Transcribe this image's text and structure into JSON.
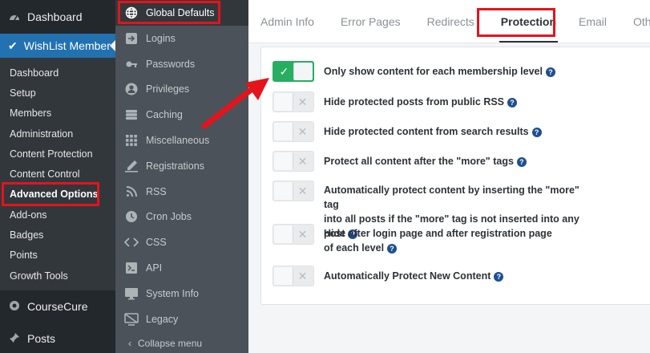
{
  "wp_sidebar": {
    "dashboard": "Dashboard",
    "wishlist": "WishList Member",
    "submenu": [
      "Dashboard",
      "Setup",
      "Members",
      "Administration",
      "Content Protection",
      "Content Control",
      "Advanced Options",
      "Add-ons",
      "Badges",
      "Points",
      "Growth Tools"
    ],
    "coursecure": "CourseCure",
    "posts": "Posts"
  },
  "wl_sidebar": {
    "items": [
      {
        "label": "Global Defaults",
        "icon": "globe-icon"
      },
      {
        "label": "Logins",
        "icon": "login-icon"
      },
      {
        "label": "Passwords",
        "icon": "key-icon"
      },
      {
        "label": "Privileges",
        "icon": "user-icon"
      },
      {
        "label": "Caching",
        "icon": "server-icon"
      },
      {
        "label": "Miscellaneous",
        "icon": "grid-icon"
      },
      {
        "label": "Registrations",
        "icon": "pen-icon"
      },
      {
        "label": "RSS",
        "icon": "rss-icon"
      },
      {
        "label": "Cron Jobs",
        "icon": "clock-icon"
      },
      {
        "label": "CSS",
        "icon": "code-icon"
      },
      {
        "label": "API",
        "icon": "api-icon"
      },
      {
        "label": "System Info",
        "icon": "monitor-icon"
      },
      {
        "label": "Legacy",
        "icon": "legacy-icon"
      }
    ],
    "collapse": "Collapse menu"
  },
  "tabs": [
    "Admin Info",
    "Error Pages",
    "Redirects",
    "Protection",
    "Email",
    "Other"
  ],
  "options": [
    {
      "line1": "Only show content for each membership level",
      "line2": "",
      "enabled": true
    },
    {
      "line1": "Hide protected posts from public RSS",
      "line2": "",
      "enabled": false
    },
    {
      "line1": "Hide protected content from search results",
      "line2": "",
      "enabled": false
    },
    {
      "line1": "Protect all content after the \"more\" tags",
      "line2": "",
      "enabled": false
    },
    {
      "line1": "Automatically protect content by inserting the \"more\" tag",
      "line2": "into all posts if the \"more\" tag is not inserted into any post",
      "enabled": false
    },
    {
      "line1": "Hide after login page and after registration page",
      "line2": "of each level",
      "enabled": false
    },
    {
      "line1": "Automatically Protect New Content",
      "line2": "",
      "enabled": false
    }
  ],
  "help_glyph": "?",
  "colors": {
    "accent": "#2271b1",
    "toggle_on": "#27ae60",
    "highlight": "#e3141b"
  }
}
